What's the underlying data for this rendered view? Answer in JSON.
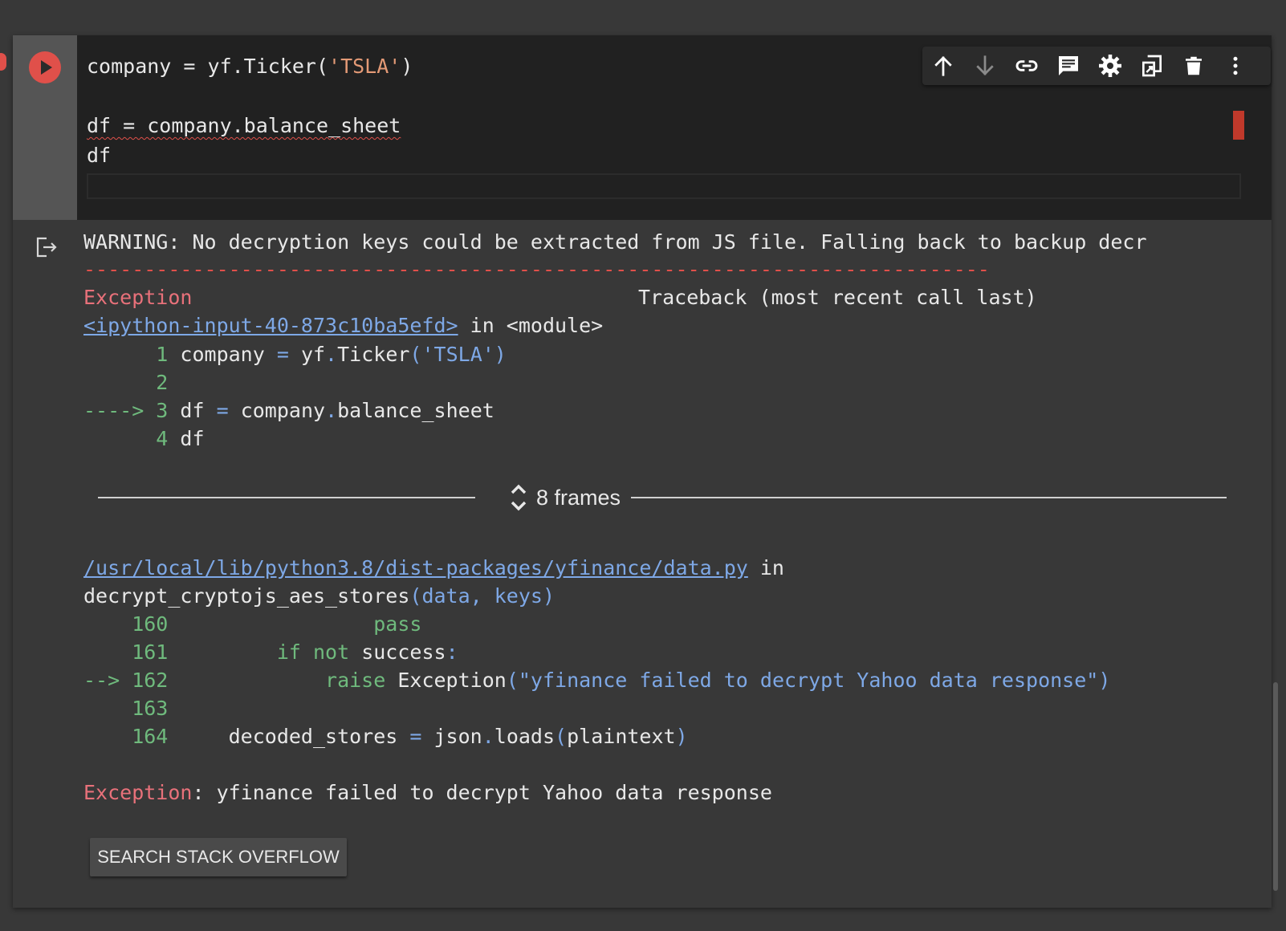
{
  "cell": {
    "code_lines": [
      {
        "plain1": "company = yf.Ticker(",
        "str": "'TSLA'",
        "plain2": ")"
      },
      {
        "text": "df = company.balance_sheet"
      },
      {
        "text": "df"
      }
    ]
  },
  "toolbar": {
    "buttons": [
      "move-up",
      "move-down",
      "link",
      "comment",
      "settings",
      "mirror-cell",
      "delete",
      "more-options"
    ]
  },
  "output": {
    "warning": "WARNING: No decryption keys could be extracted from JS file. Falling back to backup decr",
    "dashes": "---------------------------------------------------------------------------",
    "exception_name": "Exception",
    "traceback_header": "Traceback (most recent call last)",
    "frame1": {
      "link": "<ipython-input-40-873c10ba5efd>",
      "suffix": " in <module>",
      "lines": [
        {
          "prefix": "      ",
          "num": "1",
          "code_parts": [
            {
              "t": " company ",
              "c": "plain"
            },
            {
              "t": "=",
              "c": "blue"
            },
            {
              "t": " yf",
              "c": "plain"
            },
            {
              "t": ".",
              "c": "blue"
            },
            {
              "t": "Ticker",
              "c": "plain"
            },
            {
              "t": "(",
              "c": "blue"
            },
            {
              "t": "'TSLA'",
              "c": "str"
            },
            {
              "t": ")",
              "c": "blue"
            }
          ]
        },
        {
          "prefix": "      ",
          "num": "2",
          "code_parts": []
        },
        {
          "prefix": "----> ",
          "num": "3",
          "code_parts": [
            {
              "t": " df ",
              "c": "plain"
            },
            {
              "t": "=",
              "c": "blue"
            },
            {
              "t": " company",
              "c": "plain"
            },
            {
              "t": ".",
              "c": "blue"
            },
            {
              "t": "balance_sheet",
              "c": "plain"
            }
          ]
        },
        {
          "prefix": "      ",
          "num": "4",
          "code_parts": [
            {
              "t": " df",
              "c": "plain"
            }
          ]
        }
      ]
    },
    "frames_label": "8 frames",
    "frame2": {
      "link": "/usr/local/lib/python3.8/dist-packages/yfinance/data.py",
      "suffix": " in",
      "func": "decrypt_cryptojs_aes_stores",
      "args": "(data, keys)",
      "lines": [
        {
          "prefix": "    ",
          "num": "160",
          "code_parts": [
            {
              "t": "                 ",
              "c": "plain"
            },
            {
              "t": "pass",
              "c": "green"
            }
          ]
        },
        {
          "prefix": "    ",
          "num": "161",
          "code_parts": [
            {
              "t": "         ",
              "c": "plain"
            },
            {
              "t": "if",
              "c": "green"
            },
            {
              "t": " ",
              "c": "plain"
            },
            {
              "t": "not",
              "c": "green"
            },
            {
              "t": " success",
              "c": "plain"
            },
            {
              "t": ":",
              "c": "blue"
            }
          ]
        },
        {
          "prefix": "--> ",
          "num": "162",
          "code_parts": [
            {
              "t": "             ",
              "c": "plain"
            },
            {
              "t": "raise",
              "c": "green"
            },
            {
              "t": " Exception",
              "c": "plain"
            },
            {
              "t": "(\"yfinance failed to decrypt Yahoo data response\")",
              "c": "blue"
            }
          ]
        },
        {
          "prefix": "    ",
          "num": "163",
          "code_parts": []
        },
        {
          "prefix": "    ",
          "num": "164",
          "code_parts": [
            {
              "t": "     decoded_stores ",
              "c": "plain"
            },
            {
              "t": "=",
              "c": "blue"
            },
            {
              "t": " json",
              "c": "plain"
            },
            {
              "t": ".",
              "c": "blue"
            },
            {
              "t": "loads",
              "c": "plain"
            },
            {
              "t": "(",
              "c": "blue"
            },
            {
              "t": "plaintext",
              "c": "plain"
            },
            {
              "t": ")",
              "c": "blue"
            }
          ]
        }
      ]
    },
    "final_exception_name": "Exception",
    "final_exception_message": ": yfinance failed to decrypt Yahoo data response",
    "search_button": "SEARCH STACK OVERFLOW"
  },
  "colors": {
    "background": "#383838",
    "code_background": "#212121",
    "run_button": "#e0504a",
    "exception": "#e8717a",
    "line_numbers": "#6fba7d",
    "link": "#7ea8e6"
  }
}
